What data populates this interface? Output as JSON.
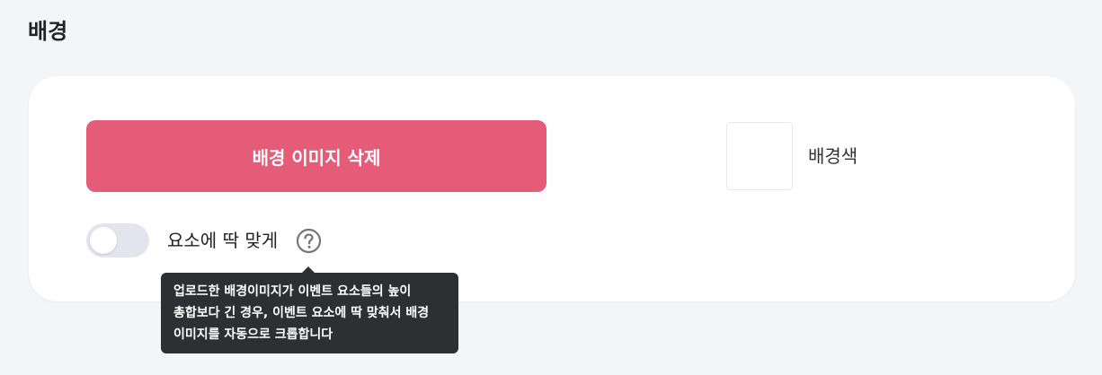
{
  "section": {
    "title": "배경"
  },
  "background": {
    "delete_image_label": "배경 이미지 삭제",
    "color_label": "배경색",
    "swatch_color": "#ffffff",
    "fit_toggle": {
      "label": "요소에 딱 맞게",
      "enabled": false
    },
    "help_icon": "question-circle-icon",
    "tooltip": {
      "lines": [
        "업로드한 배경이미지가 이벤트 요소들의 높이",
        "총합보다 긴 경우, 이벤트 요소에 딱 맞춰서 배경",
        "이미지를 자동으로 크롭합니다"
      ]
    }
  },
  "colors": {
    "accent": "#e55c79",
    "tooltip_bg": "#2d2f33",
    "page_bg": "#f4f5f9"
  }
}
